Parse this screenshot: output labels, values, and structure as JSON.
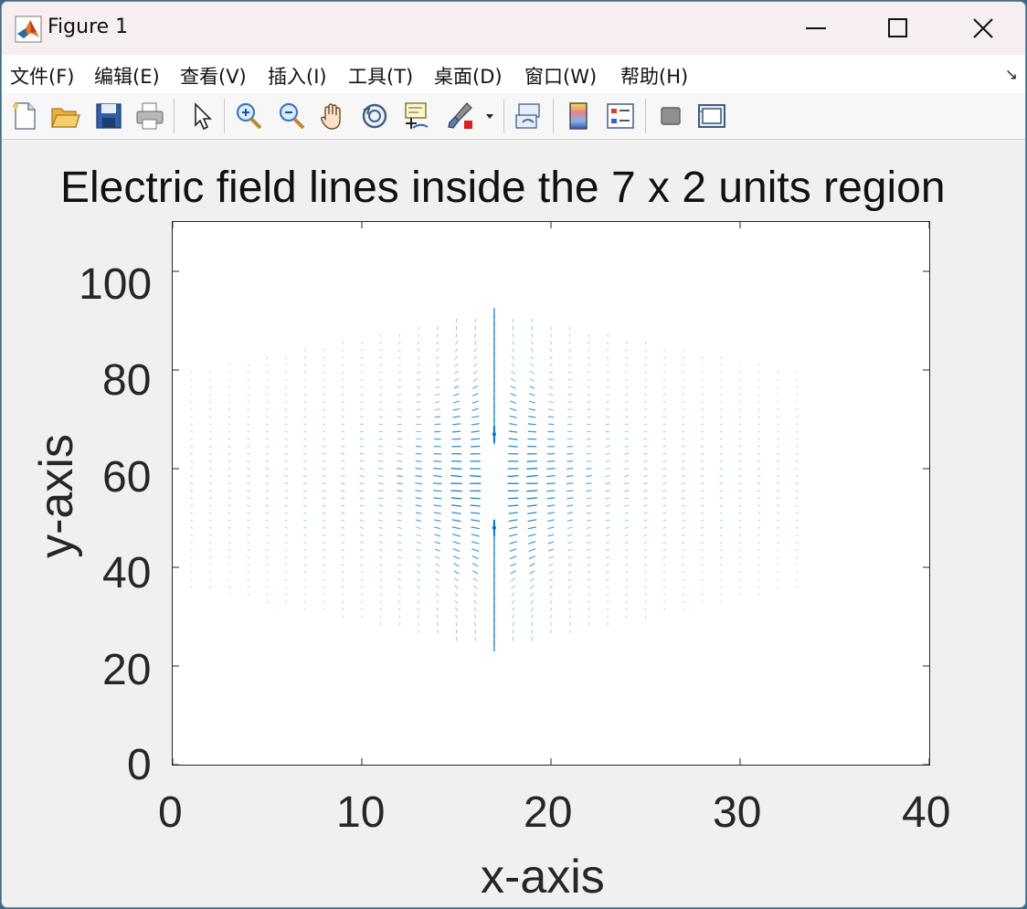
{
  "window": {
    "title": "Figure 1"
  },
  "menu": {
    "items": [
      "文件(F)",
      "编辑(E)",
      "查看(V)",
      "插入(I)",
      "工具(T)",
      "桌面(D)",
      "窗口(W)",
      "帮助(H)"
    ]
  },
  "toolbar": {
    "icons": [
      "new-figure-icon",
      "open-file-icon",
      "save-icon",
      "print-icon",
      "select-arrow-icon",
      "zoom-in-icon",
      "zoom-out-icon",
      "pan-hand-icon",
      "rotate-3d-icon",
      "data-cursor-icon",
      "brush-icon",
      "brush-dropdown-icon",
      "link-plot-icon",
      "colorbar-icon",
      "legend-icon",
      "hide-plot-tools-icon",
      "show-plot-tools-icon"
    ]
  },
  "chart_data": {
    "type": "quiver",
    "title": "Electric field lines inside the 7 x 2 units region",
    "xlabel": "x-axis",
    "ylabel": "y-axis",
    "xlim": [
      0,
      40
    ],
    "ylim": [
      0,
      110
    ],
    "xticks": [
      "0",
      "10",
      "20",
      "30",
      "40"
    ],
    "yticks": [
      "0",
      "20",
      "40",
      "60",
      "80",
      "100"
    ],
    "grid": false,
    "series_color": "#0072bd",
    "field": {
      "x_range": [
        1,
        33
      ],
      "y_range": [
        24,
        92
      ],
      "charges": [
        {
          "x": 17,
          "y": 67
        },
        {
          "x": 17,
          "y": 48
        }
      ]
    }
  }
}
